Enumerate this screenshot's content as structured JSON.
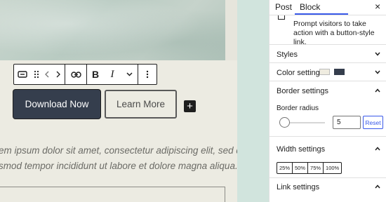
{
  "editor": {
    "toolbar": {
      "bold_label": "B",
      "italic_label": "I",
      "dropdown_icon": "chevron-down-icon",
      "more_icon": "more-vertical-icon"
    },
    "buttons": {
      "primary_label": "Download Now",
      "secondary_label": "Learn More",
      "inserter_label": "+"
    },
    "paragraph": {
      "line1": "em ipsum dolor sit amet, consectetur adipiscing elit, sed do",
      "line2": "smod tempor incididunt ut labore et dolore magna aliqua."
    }
  },
  "sidebar": {
    "tabs": [
      "Post",
      "Block"
    ],
    "active_tab": "Block",
    "close_label": "×",
    "block_description": "Prompt visitors to take action with a button-style link.",
    "panels": {
      "styles": {
        "title": "Styles",
        "open": false
      },
      "color": {
        "title": "Color settings",
        "open": false,
        "swatches": [
          "#efece0",
          "#353e4d"
        ]
      },
      "border": {
        "title": "Border settings",
        "open": true,
        "radius_label": "Border radius",
        "radius_value": "5",
        "reset_label": "Reset"
      },
      "width": {
        "title": "Width settings",
        "open": true,
        "options": [
          "25%",
          "50%",
          "75%",
          "100%"
        ]
      },
      "link": {
        "title": "Link settings",
        "open": true
      }
    }
  },
  "colors": {
    "accent": "#3858e9",
    "primary_button": "#353e4d",
    "canvas_background": "#ecebe2",
    "side_strip": "#d1e4dd"
  }
}
